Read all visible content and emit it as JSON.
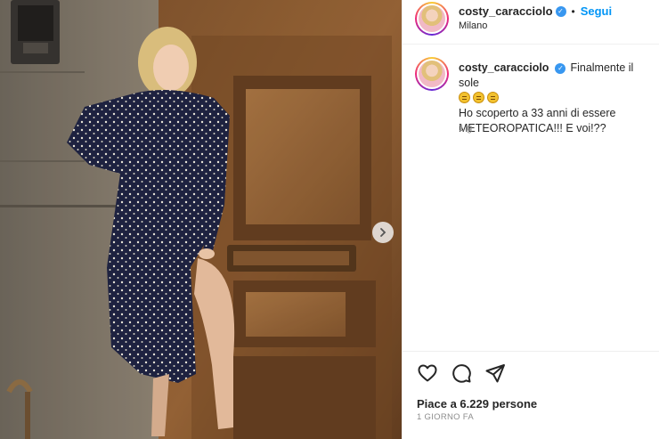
{
  "post": {
    "username": "costy_caracciolo",
    "follow_label": "Segui",
    "location": "Milano",
    "caption_line1": "Finalmente il sole",
    "caption_line2": "Ho scoperto a 33 anni di essere METEOROPATICA!!! E voi!??",
    "time_ago": "1 g",
    "likes_text": "Piace a 6.229 persone",
    "date_text": "1 GIORNO FA"
  },
  "icons": {
    "verified": "verified-badge-icon",
    "next": "chevron-right-icon",
    "like": "heart-icon",
    "comment": "comment-icon",
    "share": "send-icon",
    "emoji": "sun-emoji-icon"
  },
  "colors": {
    "accent": "#0095f6",
    "verified": "#3897f0",
    "muted": "#8e8e8e"
  }
}
